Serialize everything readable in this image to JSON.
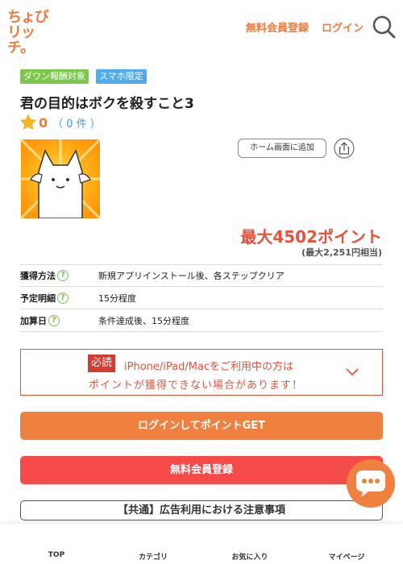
{
  "header": {
    "logo_line1": "ちょび",
    "logo_line2": "リッチ。",
    "signup_label": "無料会員登録",
    "login_label": "ログイン",
    "search_icon": "search-icon"
  },
  "offer": {
    "badges": [
      "ダウン報酬対象",
      "スマホ限定"
    ],
    "title": "君の目的はボクを殺すこと3",
    "rating_score": "0",
    "rating_count": "（ 0 件 ）",
    "home_add_label": "ホーム画面に追加",
    "points": "最大4502ポイント",
    "points_sub": "(最大2,251円相当)"
  },
  "info": [
    {
      "label": "獲得方法",
      "value": "新規アプリインストール後、各ステップクリア"
    },
    {
      "label": "予定明細",
      "value": "15分程度"
    },
    {
      "label": "加算日",
      "value": "条件達成後、15分程度"
    }
  ],
  "notice": {
    "tag": "必読",
    "line1": "iPhone/iPad/Macをご利用中の方は",
    "line2": "ポイントが獲得できない場合があります！"
  },
  "actions": {
    "login_get": "ログインしてポイントGET",
    "signup": "無料会員登録",
    "caution": "【共通】広告利用における注意事項"
  },
  "bottom_nav": [
    "TOP",
    "カテゴリ",
    "お気に入り",
    "マイページ"
  ],
  "colors": {
    "brand": "#ef7a3e",
    "alert": "#e5533d",
    "signup": "#f44a4a"
  }
}
